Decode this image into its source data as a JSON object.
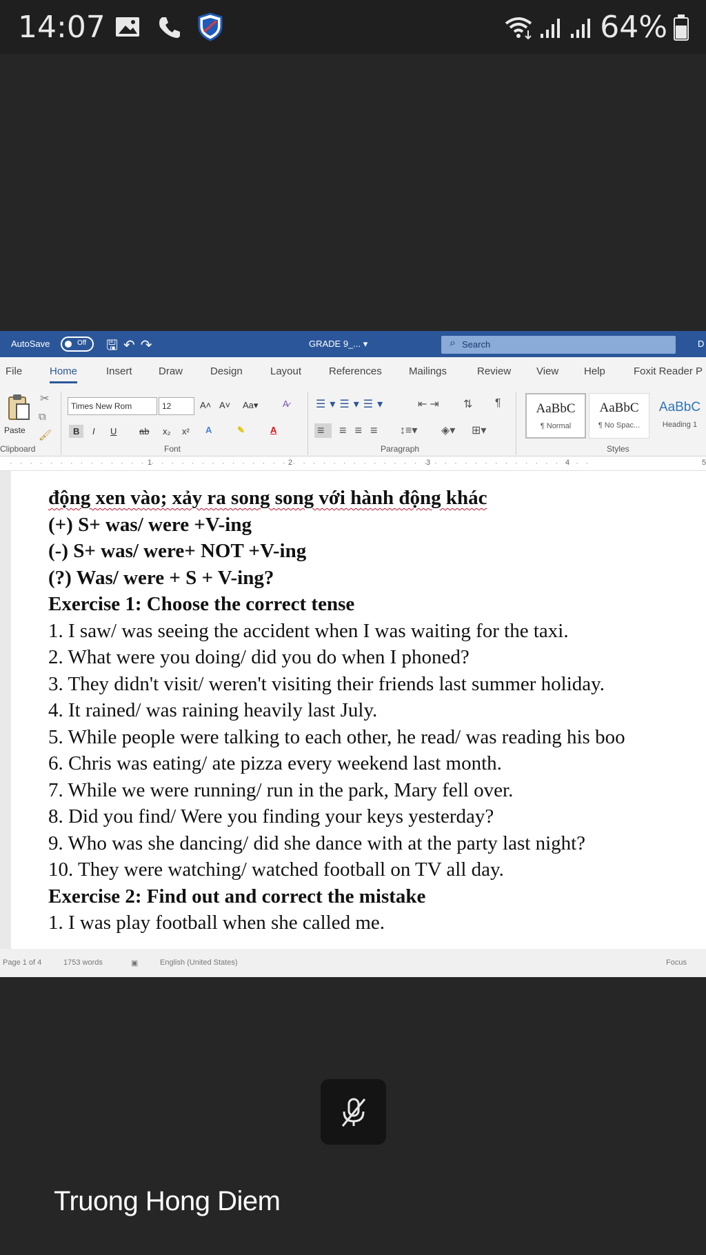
{
  "status_bar": {
    "time": "14:07",
    "icons_left": [
      "image-icon",
      "phone-icon",
      "shield-icon"
    ],
    "icons_right": [
      "wifi-icon",
      "signal-icon",
      "signal-icon",
      "battery-icon"
    ],
    "battery": "64%"
  },
  "word": {
    "autosave_label": "AutoSave",
    "autosave_state": "Off",
    "document_title": "GRADE 9_... ▾",
    "search_placeholder": "Search",
    "title_right": "D",
    "tabs": [
      "File",
      "Home",
      "Insert",
      "Draw",
      "Design",
      "Layout",
      "References",
      "Mailings",
      "Review",
      "View",
      "Help",
      "Foxit Reader P"
    ],
    "active_tab": "Home",
    "ribbon": {
      "paste_label": "Paste",
      "font_name": "Times New Rom",
      "font_size": "12",
      "grow": "A˄",
      "shrink": "A˅",
      "change_case": "Aa▾",
      "bold": "B",
      "italic": "I",
      "underline": "U",
      "strike": "ab",
      "subscript": "x₂",
      "superscript": "x²",
      "groups": {
        "clipboard": "Clipboard",
        "font": "Font",
        "paragraph": "Paragraph",
        "styles": "Styles"
      },
      "styles": [
        {
          "preview": "AaBbC",
          "name": "¶ Normal"
        },
        {
          "preview": "AaBbC",
          "name": "¶ No Spac..."
        },
        {
          "preview": "AaBbC",
          "name": "Heading 1"
        }
      ]
    },
    "ruler_numbers": [
      "1",
      "2",
      "3",
      "4",
      "5"
    ],
    "status": {
      "page": "Page 1 of 4",
      "words": "1753 words",
      "language": "English (United States)",
      "focus": "Focus"
    }
  },
  "document": {
    "lines": [
      "động xen vào; xảy ra song song với hành động khác",
      "(+) S+ was/ were +V-ing",
      "(-) S+ was/ were+ NOT +V-ing",
      "(?) Was/ were + S + V-ing?",
      "Exercise 1: Choose the correct tense",
      "1. I saw/ was seeing the accident when I was waiting for the taxi.",
      "2. What were you doing/ did you do when I phoned?",
      "3. They didn't visit/ weren't visiting their friends last summer holiday.",
      "4. It rained/ was raining heavily last July.",
      "5. While people were talking to each other, he read/ was reading his boo",
      "6. Chris was eating/ ate pizza every weekend last month.",
      "7. While we were running/ run in the park, Mary fell over.",
      "8. Did you find/ Were you finding your keys yesterday?",
      "9. Who was she dancing/ did she dance with at the party last night?",
      "10. They were watching/ watched football on TV all day.",
      "Exercise 2: Find out and correct the mistake",
      "1. I was play football when she called me."
    ]
  },
  "call": {
    "participant_name": "Truong Hong Diem",
    "mic_state": "muted"
  }
}
